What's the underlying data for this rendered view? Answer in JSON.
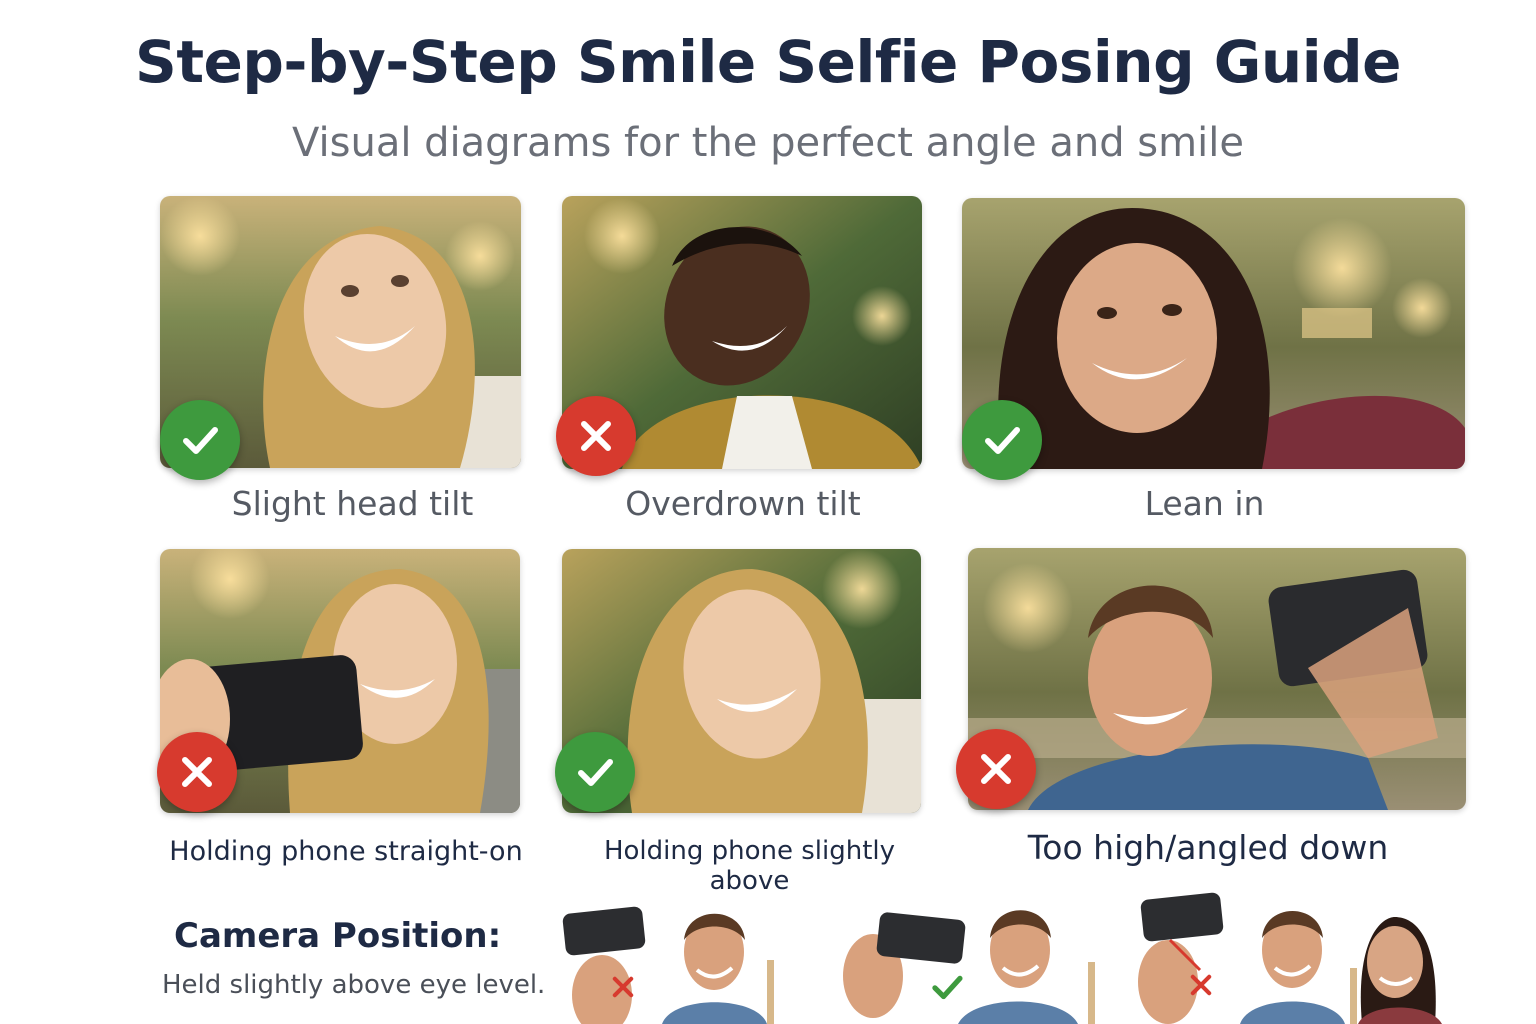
{
  "header": {
    "title": "Step-by-Step Smile Selfie Posing Guide",
    "subtitle": "Visual diagrams for the perfect angle and smile"
  },
  "poses": [
    {
      "caption": "Slight head tilt",
      "verdict": "correct",
      "badge_icon": "check-icon"
    },
    {
      "caption": "Overdrown tilt",
      "verdict": "incorrect",
      "badge_icon": "cross-icon"
    },
    {
      "caption": "Lean in",
      "verdict": "correct",
      "badge_icon": "check-icon"
    },
    {
      "caption": "Holding phone straight-on",
      "verdict": "incorrect",
      "badge_icon": "cross-icon"
    },
    {
      "caption": "Holding phone slightly above",
      "verdict": "correct",
      "badge_icon": "check-icon"
    },
    {
      "caption": "Too high/angled down",
      "verdict": "incorrect",
      "badge_icon": "cross-icon"
    }
  ],
  "camera_position": {
    "heading": "Camera Position:",
    "description": "Held slightly above eye level.",
    "diagrams": [
      {
        "verdict": "incorrect",
        "mark_icon": "cross-icon"
      },
      {
        "verdict": "correct",
        "mark_icon": "check-icon"
      },
      {
        "verdict": "incorrect",
        "mark_icon": "cross-icon"
      }
    ]
  },
  "colors": {
    "title": "#1e2a44",
    "correct": "#3e9a3e",
    "incorrect": "#d73a2e"
  }
}
